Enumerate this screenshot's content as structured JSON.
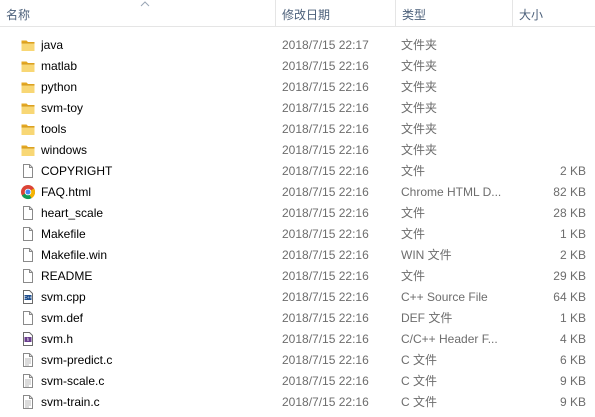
{
  "columns": {
    "name": "名称",
    "date": "修改日期",
    "type": "类型",
    "size": "大小"
  },
  "files": [
    {
      "name": "java",
      "date": "2018/7/15 22:17",
      "type": "文件夹",
      "size": "",
      "icon": "folder-icon"
    },
    {
      "name": "matlab",
      "date": "2018/7/15 22:16",
      "type": "文件夹",
      "size": "",
      "icon": "folder-icon"
    },
    {
      "name": "python",
      "date": "2018/7/15 22:16",
      "type": "文件夹",
      "size": "",
      "icon": "folder-icon"
    },
    {
      "name": "svm-toy",
      "date": "2018/7/15 22:16",
      "type": "文件夹",
      "size": "",
      "icon": "folder-icon"
    },
    {
      "name": "tools",
      "date": "2018/7/15 22:16",
      "type": "文件夹",
      "size": "",
      "icon": "folder-icon"
    },
    {
      "name": "windows",
      "date": "2018/7/15 22:16",
      "type": "文件夹",
      "size": "",
      "icon": "folder-icon"
    },
    {
      "name": "COPYRIGHT",
      "date": "2018/7/15 22:16",
      "type": "文件",
      "size": "2 KB",
      "icon": "file-icon"
    },
    {
      "name": "FAQ.html",
      "date": "2018/7/15 22:16",
      "type": "Chrome HTML D...",
      "size": "82 KB",
      "icon": "chrome-icon"
    },
    {
      "name": "heart_scale",
      "date": "2018/7/15 22:16",
      "type": "文件",
      "size": "28 KB",
      "icon": "file-icon"
    },
    {
      "name": "Makefile",
      "date": "2018/7/15 22:16",
      "type": "文件",
      "size": "1 KB",
      "icon": "file-icon"
    },
    {
      "name": "Makefile.win",
      "date": "2018/7/15 22:16",
      "type": "WIN 文件",
      "size": "2 KB",
      "icon": "file-icon"
    },
    {
      "name": "README",
      "date": "2018/7/15 22:16",
      "type": "文件",
      "size": "29 KB",
      "icon": "file-icon"
    },
    {
      "name": "svm.cpp",
      "date": "2018/7/15 22:16",
      "type": "C++ Source File",
      "size": "64 KB",
      "icon": "cpp-source-icon"
    },
    {
      "name": "svm.def",
      "date": "2018/7/15 22:16",
      "type": "DEF 文件",
      "size": "1 KB",
      "icon": "file-icon"
    },
    {
      "name": "svm.h",
      "date": "2018/7/15 22:16",
      "type": "C/C++ Header F...",
      "size": "4 KB",
      "icon": "cpp-header-icon"
    },
    {
      "name": "svm-predict.c",
      "date": "2018/7/15 22:16",
      "type": "C 文件",
      "size": "6 KB",
      "icon": "text-file-icon"
    },
    {
      "name": "svm-scale.c",
      "date": "2018/7/15 22:16",
      "type": "C 文件",
      "size": "9 KB",
      "icon": "text-file-icon"
    },
    {
      "name": "svm-train.c",
      "date": "2018/7/15 22:16",
      "type": "C 文件",
      "size": "9 KB",
      "icon": "text-file-icon"
    }
  ],
  "colors": {
    "header_text": "#4c607a",
    "meta_text": "#6d6d6d",
    "folder": "#f4c656"
  }
}
